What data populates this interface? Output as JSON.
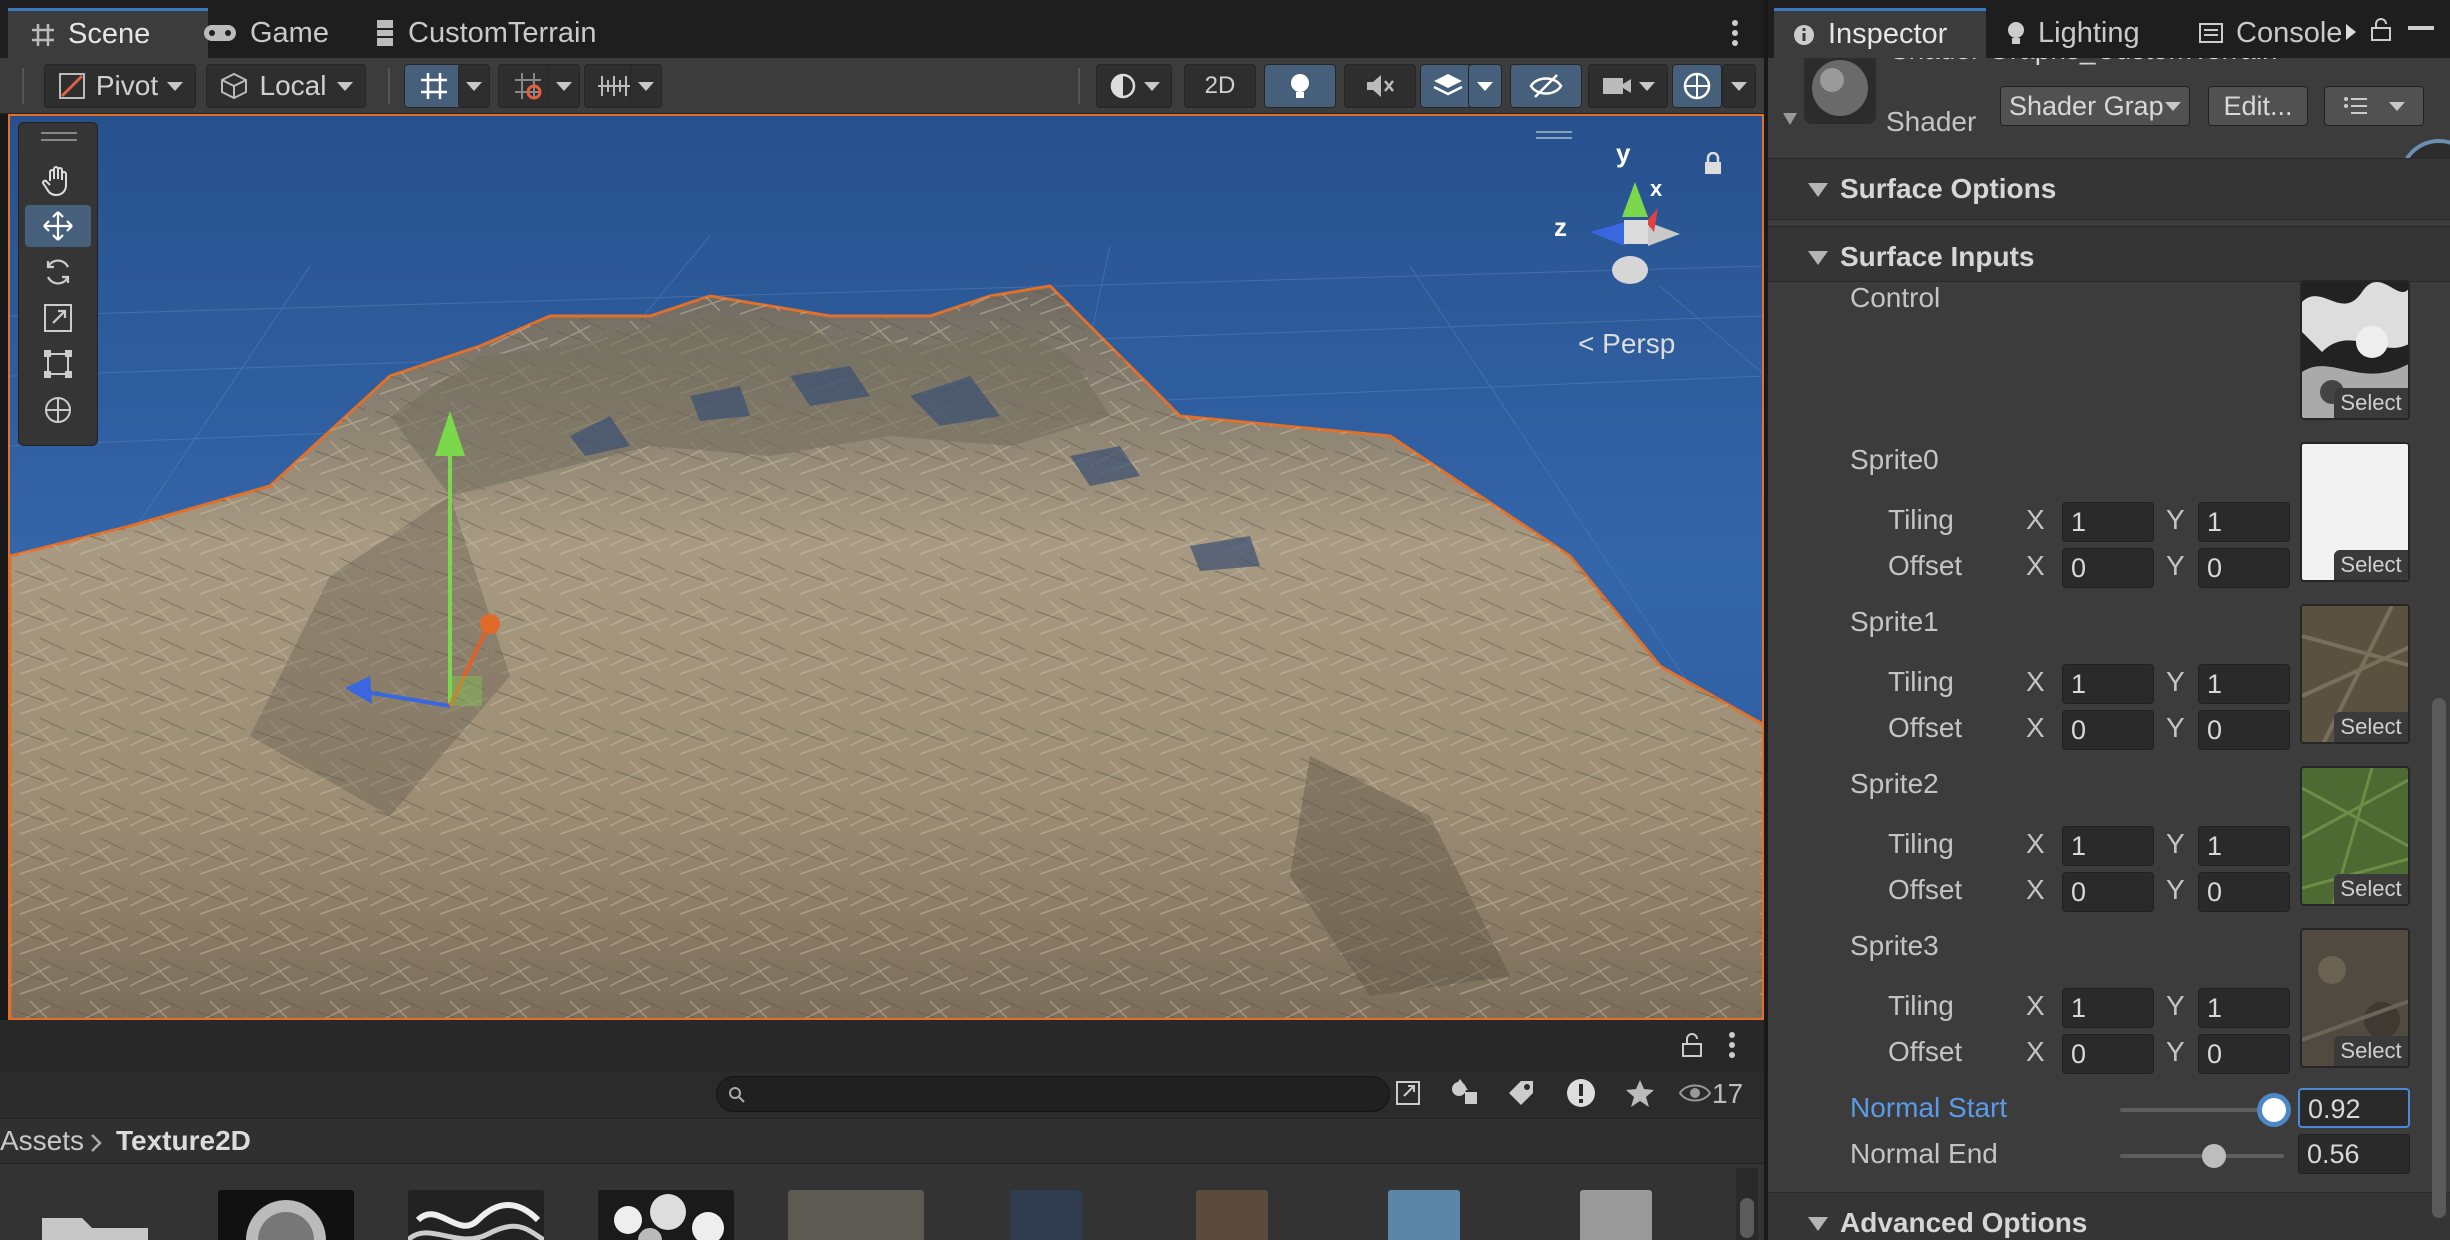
{
  "scene_tabs": {
    "scene": "Scene",
    "game": "Game",
    "custom_terrain": "CustomTerrain"
  },
  "inspector_tabs": {
    "inspector": "Inspector",
    "lighting": "Lighting",
    "console": "Console"
  },
  "toolbar": {
    "pivot": "Pivot",
    "local": "Local",
    "mode_2d": "2D"
  },
  "viewport": {
    "gizmo_axes": {
      "y": "y",
      "x": "x",
      "z": "z"
    },
    "projection": "Persp",
    "sky_color": "#2f5c9c",
    "selection_outline_color": "#e0702a"
  },
  "project": {
    "breadcrumb_root": "Assets",
    "breadcrumb_current": "Texture2D",
    "search_placeholder": "",
    "visible_count": "17"
  },
  "inspector": {
    "material_name": "Shader Graphs_CustomTerrain",
    "shader_label": "Shader",
    "shader_value": "Shader Grap",
    "edit_button": "Edit...",
    "sections": {
      "surface_options": "Surface Options",
      "surface_inputs": "Surface Inputs",
      "advanced_options": "Advanced Options"
    },
    "control_label": "Control",
    "select_label": "Select",
    "tiling_label": "Tiling",
    "offset_label": "Offset",
    "x_label": "X",
    "y_label": "Y",
    "sprites": [
      {
        "name": "Sprite0",
        "tiling_x": "1",
        "tiling_y": "1",
        "offset_x": "0",
        "offset_y": "0",
        "texture": "white"
      },
      {
        "name": "Sprite1",
        "tiling_x": "1",
        "tiling_y": "1",
        "offset_x": "0",
        "offset_y": "0",
        "texture": "dirt"
      },
      {
        "name": "Sprite2",
        "tiling_x": "1",
        "tiling_y": "1",
        "offset_x": "0",
        "offset_y": "0",
        "texture": "grass"
      },
      {
        "name": "Sprite3",
        "tiling_x": "1",
        "tiling_y": "1",
        "offset_x": "0",
        "offset_y": "0",
        "texture": "rock"
      }
    ],
    "normal_start_label": "Normal Start",
    "normal_start_value": "0.92",
    "normal_end_label": "Normal End",
    "normal_end_value": "0.56"
  }
}
